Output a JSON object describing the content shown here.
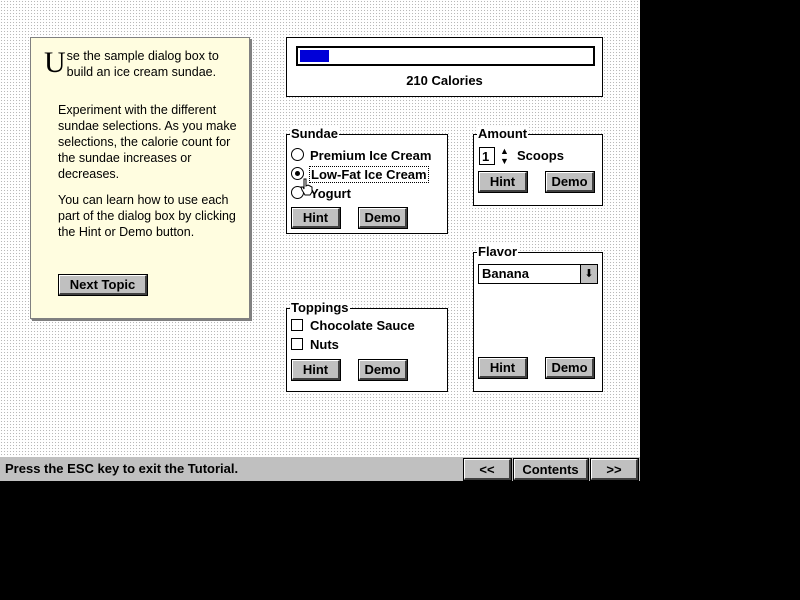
{
  "info": {
    "intro_first_letter": "U",
    "intro_rest": "se the sample dialog box to build an ice cream sundae.",
    "paragraph2": "Experiment with the different sundae selections. As you make selections, the calorie count for the sundae increases or decreases.",
    "paragraph3": "You can learn how to use each part of the dialog box by clicking the Hint or Demo button.",
    "next_topic_label": "Next Topic"
  },
  "calories": {
    "label": "210 Calories",
    "progress_fraction": 0.1
  },
  "sundae": {
    "title": "Sundae",
    "options": [
      "Premium Ice Cream",
      "Low-Fat Ice Cream",
      "Yogurt"
    ],
    "selected": "Low-Fat Ice Cream",
    "hint_label": "Hint",
    "demo_label": "Demo"
  },
  "amount": {
    "title": "Amount",
    "value": "1",
    "unit_label": "Scoops",
    "hint_label": "Hint",
    "demo_label": "Demo"
  },
  "flavor": {
    "title": "Flavor",
    "selected": "Banana",
    "hint_label": "Hint",
    "demo_label": "Demo"
  },
  "toppings": {
    "title": "Toppings",
    "options": [
      "Chocolate Sauce",
      "Nuts"
    ],
    "hint_label": "Hint",
    "demo_label": "Demo"
  },
  "status_bar": {
    "text": "Press the ESC key to exit the Tutorial.",
    "prev_label": "<<",
    "contents_label": "Contents",
    "next_label": ">>"
  },
  "colors": {
    "panel_bg": "#fffde0",
    "progress_fill": "#0000d8",
    "button_face": "#c0c0c0"
  }
}
